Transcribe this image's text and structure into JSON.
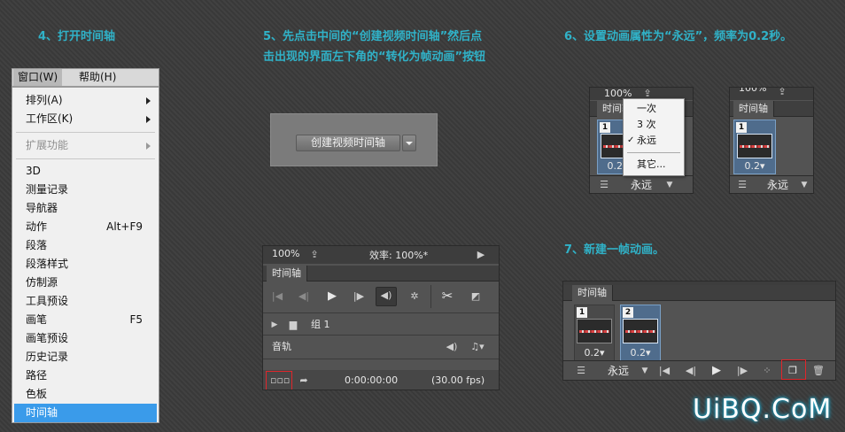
{
  "steps": {
    "step4": "4、打开时间轴",
    "step5_line1": "5、先点击中间的“创建视频时间轴”然后点",
    "step5_line2": "击出现的界面左下角的“转化为帧动画”按钮",
    "step6": "6、设置动画属性为“永远”，频率为0.2秒。",
    "step7": "7、新建一帧动画。"
  },
  "menubar": {
    "window": "窗口(W)",
    "help": "帮助(H)"
  },
  "menu_items": [
    {
      "label": "排列(A)",
      "submenu": true
    },
    {
      "label": "工作区(K)",
      "submenu": true
    },
    {
      "label": "扩展功能",
      "submenu": true,
      "disabled": true
    },
    {
      "label": "3D"
    },
    {
      "label": "测量记录"
    },
    {
      "label": "导航器"
    },
    {
      "label": "动作",
      "shortcut": "Alt+F9"
    },
    {
      "label": "段落"
    },
    {
      "label": "段落样式"
    },
    {
      "label": "仿制源"
    },
    {
      "label": "工具预设"
    },
    {
      "label": "画笔",
      "shortcut": "F5"
    },
    {
      "label": "画笔预设"
    },
    {
      "label": "历史记录"
    },
    {
      "label": "路径"
    },
    {
      "label": "色板"
    },
    {
      "label": "时间轴",
      "selected": true
    }
  ],
  "create_timeline": {
    "button": "创建视频时间轴"
  },
  "video_timeline": {
    "zoom": "100%",
    "efficiency": "效率: 100%*",
    "tab": "时间轴",
    "group_label": "组 1",
    "audio_track": "音轨",
    "timecode": "0:00:00:00",
    "fps": "(30.00 fps)"
  },
  "anim_panel_1": {
    "zoom": "100%",
    "tab": "时间轴",
    "frame_number": "1",
    "frame_delay": "0.2",
    "loop": "永远"
  },
  "loop_menu": {
    "items": [
      "一次",
      "3 次",
      "永远",
      "其它..."
    ],
    "checked": "永远"
  },
  "anim_panel_2": {
    "zoom": "100%",
    "tab": "时间轴",
    "frame_number": "1",
    "frame_delay": "0.2",
    "loop": "永远"
  },
  "anim_panel_3": {
    "tab": "时间轴",
    "frames": [
      {
        "number": "1",
        "delay": "0.2"
      },
      {
        "number": "2",
        "delay": "0.2"
      }
    ],
    "loop": "永远"
  },
  "watermark": "UiBQ.CoM",
  "colors": {
    "title": "#30b2c8",
    "highlight": "#e0262b",
    "menu_selected": "#3a9bea"
  }
}
